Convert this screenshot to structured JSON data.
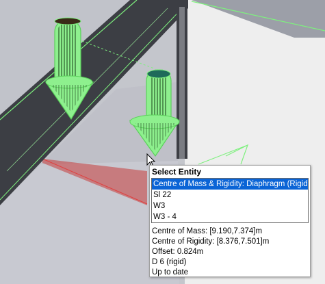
{
  "colors": {
    "background_far": "#eeeeee",
    "beam": "#3c3e44",
    "floor": "#c7c8d0",
    "wireframe": "#7ef07e",
    "selection": "#0a64d6"
  },
  "popup": {
    "title": "Select Entity",
    "items": [
      {
        "label": "Centre of Mass & Rigidity: Diaphragm (Rigid)",
        "selected": true
      },
      {
        "label": "Sl 22",
        "selected": false
      },
      {
        "label": "W3",
        "selected": false
      },
      {
        "label": "W3 - 4",
        "selected": false
      }
    ],
    "details": [
      "Centre of Mass: [9.190,7.374]m",
      "Centre of Rigidity: [8.376,7.501]m",
      "Offset: 0.824m",
      "D 6 (rigid)",
      "Up to date"
    ]
  },
  "icons": [
    "arrow-pointer-icon"
  ]
}
